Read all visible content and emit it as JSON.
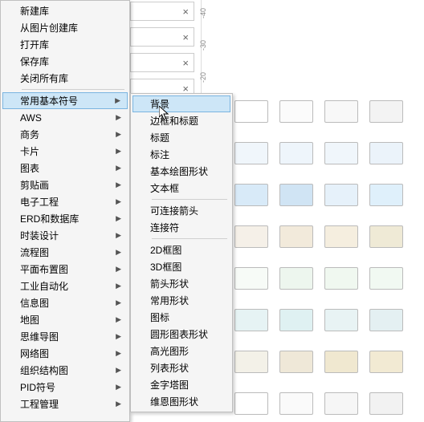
{
  "main_menu": {
    "items_top": [
      "新建库",
      "从图片创建库",
      "打开库",
      "保存库",
      "关闭所有库"
    ],
    "items_bottom": {
      "highlighted": "常用基本符号",
      "rest": [
        "AWS",
        "商务",
        "卡片",
        "图表",
        "剪贴画",
        "电子工程",
        "ERD和数据库",
        "时装设计",
        "流程图",
        "平面布置图",
        "工业自动化",
        "信息图",
        "地图",
        "思维导图",
        "网络图",
        "组织结构图",
        "PID符号",
        "工程管理"
      ]
    }
  },
  "submenu": {
    "highlighted": "背景",
    "group1": [
      "边框和标题",
      "标题",
      "标注",
      "基本绘图形状",
      "文本框"
    ],
    "group2": [
      "可连接箭头",
      "连接符"
    ],
    "group3": [
      "2D框图",
      "3D框图",
      "箭头形状",
      "常用形状",
      "图标",
      "圆形图表形状",
      "高光图形",
      "列表形状",
      "金字塔图",
      "维恩图形状"
    ]
  },
  "input_close": "×",
  "ruler_labels": [
    "-40",
    "-30",
    "-20"
  ],
  "grid": {
    "rows": [
      [
        "#ffffff",
        "#fbfbfb",
        "#f8f8f8",
        "#f3f3f3"
      ],
      [
        "#f0f6fb",
        "#eef5fb",
        "#f0f6fb",
        "#ebf3fa"
      ],
      [
        "#d8eaf8",
        "#d0e4f4",
        "#e6f1fa",
        "#dff0fb"
      ],
      [
        "#f5f0e8",
        "#f2eadb",
        "#f5eedf",
        "#efead6"
      ],
      [
        "#f7fbf7",
        "#edf6ee",
        "#f0f8f0",
        "#f1f9f2"
      ],
      [
        "#e6f3f4",
        "#dff1f2",
        "#e8f3f4",
        "#e4f0f2"
      ],
      [
        "#f3f1e8",
        "#efe8d8",
        "#f0e8d0",
        "#f2ead3"
      ],
      [
        "#ffffff",
        "#fafafa",
        "#f6f6f6",
        "#f2f2f2"
      ]
    ]
  }
}
